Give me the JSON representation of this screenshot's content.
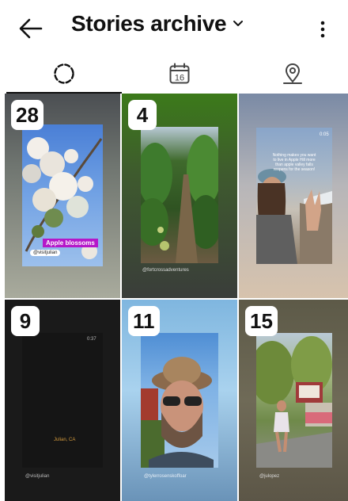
{
  "header": {
    "title": "Stories archive",
    "back_icon": "back-arrow-icon",
    "more_icon": "more-vertical-icon",
    "dropdown_icon": "chevron-down-icon"
  },
  "tabs": [
    {
      "name": "stories",
      "icon": "stories-circle-icon",
      "selected": true
    },
    {
      "name": "calendar",
      "icon": "calendar-icon",
      "day": "16",
      "selected": false
    },
    {
      "name": "map",
      "icon": "map-pin-icon",
      "selected": false
    }
  ],
  "tiles": [
    {
      "count": "28",
      "handle": "@visitjulian",
      "sticker": "Apple blossoms"
    },
    {
      "count": "4",
      "handle": "@fortcrossadventures"
    },
    {
      "count": "",
      "time": "0:05",
      "overlay": "Nothing makes you want to live in Apple Hill more than apple valley falls reopens for the season!"
    },
    {
      "count": "9",
      "handle": "@visitjulian",
      "location": "Julian, CA",
      "time": "0:37"
    },
    {
      "count": "11",
      "handle": "@tylerrosenskoffoar"
    },
    {
      "count": "15",
      "handle": "@julopez"
    }
  ],
  "colors": {
    "accent": "#b517c9",
    "indicator": "#111111"
  }
}
